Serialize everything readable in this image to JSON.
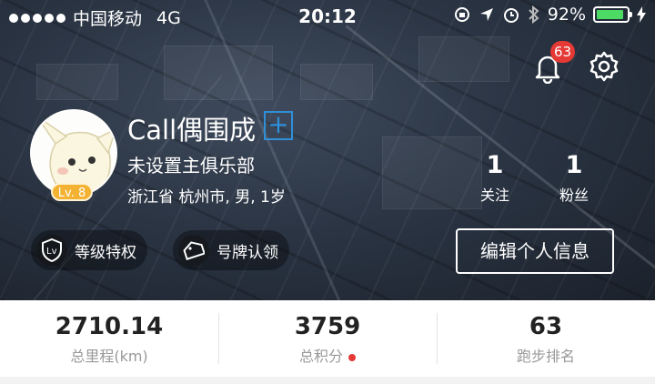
{
  "status_bar": {
    "carrier": "中国移动",
    "network": "4G",
    "time": "20:12",
    "battery": "92%",
    "battery_level": 0.92,
    "icons": [
      "orientation-lock-icon",
      "location-icon",
      "alarm-icon",
      "bluetooth-icon",
      "charging-icon"
    ]
  },
  "header": {
    "notification_count": "63"
  },
  "profile": {
    "username": "Call偶围成",
    "level": "Lv. 8",
    "club": "未设置主俱乐部",
    "location_info": "浙江省 杭州市, 男, 1岁"
  },
  "social": {
    "following_count": "1",
    "following_label": "关注",
    "followers_count": "1",
    "followers_label": "粉丝"
  },
  "actions": {
    "level_privilege": "等级特权",
    "plate_claim": "号牌认领",
    "edit_profile": "编辑个人信息"
  },
  "stats": [
    {
      "value": "2710.14",
      "label": "总里程(km)"
    },
    {
      "value": "3759",
      "label": "总积分"
    },
    {
      "value": "63",
      "label": "跑步排名"
    }
  ],
  "colors": {
    "badge_red": "#e53935",
    "add_blue": "#2f8fd8",
    "level_gold": "#f4b233",
    "battery_green": "#4cd964"
  }
}
